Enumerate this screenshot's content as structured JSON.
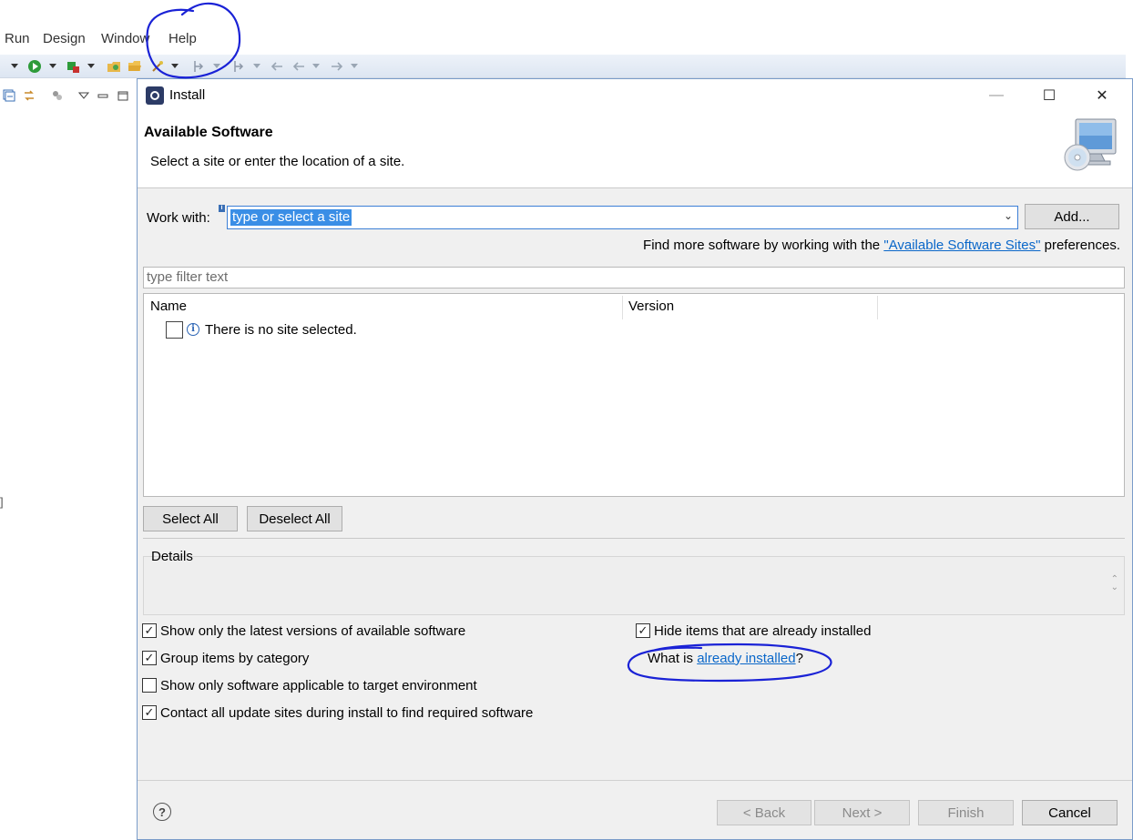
{
  "menubar": {
    "items": [
      "Run",
      "Design",
      "Window",
      "Help"
    ]
  },
  "dialog": {
    "title": "Install",
    "window_controls": {
      "minimize": "—",
      "maximize": "☐",
      "close": "✕"
    },
    "header": {
      "title": "Available Software",
      "subtitle": "Select a site or enter the location of a site."
    },
    "work_with": {
      "label": "Work with:",
      "value": "type or select a site",
      "add_button": "Add..."
    },
    "find_more": {
      "prefix": "Find more software by working with the ",
      "link": "\"Available Software Sites\"",
      "suffix": " preferences."
    },
    "filter_placeholder": "type filter text",
    "tree": {
      "columns": [
        "Name",
        "Version"
      ],
      "message": "There is no site selected."
    },
    "select_all_button": "Select All",
    "deselect_all_button": "Deselect All",
    "details_label": "Details",
    "options": {
      "latest_versions": {
        "label": "Show only the latest versions of available software",
        "checked": true
      },
      "group_by_category": {
        "label": "Group items by category",
        "checked": true
      },
      "applicable_target": {
        "label": "Show only software applicable to target environment",
        "checked": false
      },
      "contact_sites": {
        "label": "Contact all update sites during install to find required software",
        "checked": true
      },
      "hide_installed": {
        "label": "Hide items that are already installed",
        "checked": true
      }
    },
    "already_installed": {
      "prefix": "What is ",
      "link": "already installed",
      "suffix": "?"
    },
    "footer": {
      "help": "?",
      "back": "< Back",
      "next": "Next >",
      "finish": "Finish",
      "cancel": "Cancel"
    }
  },
  "colors": {
    "link": "#0a67c9",
    "selection": "#3a8ee6",
    "annotation_ink": "#1a22d6",
    "dialog_bg": "#f0f0f0"
  }
}
